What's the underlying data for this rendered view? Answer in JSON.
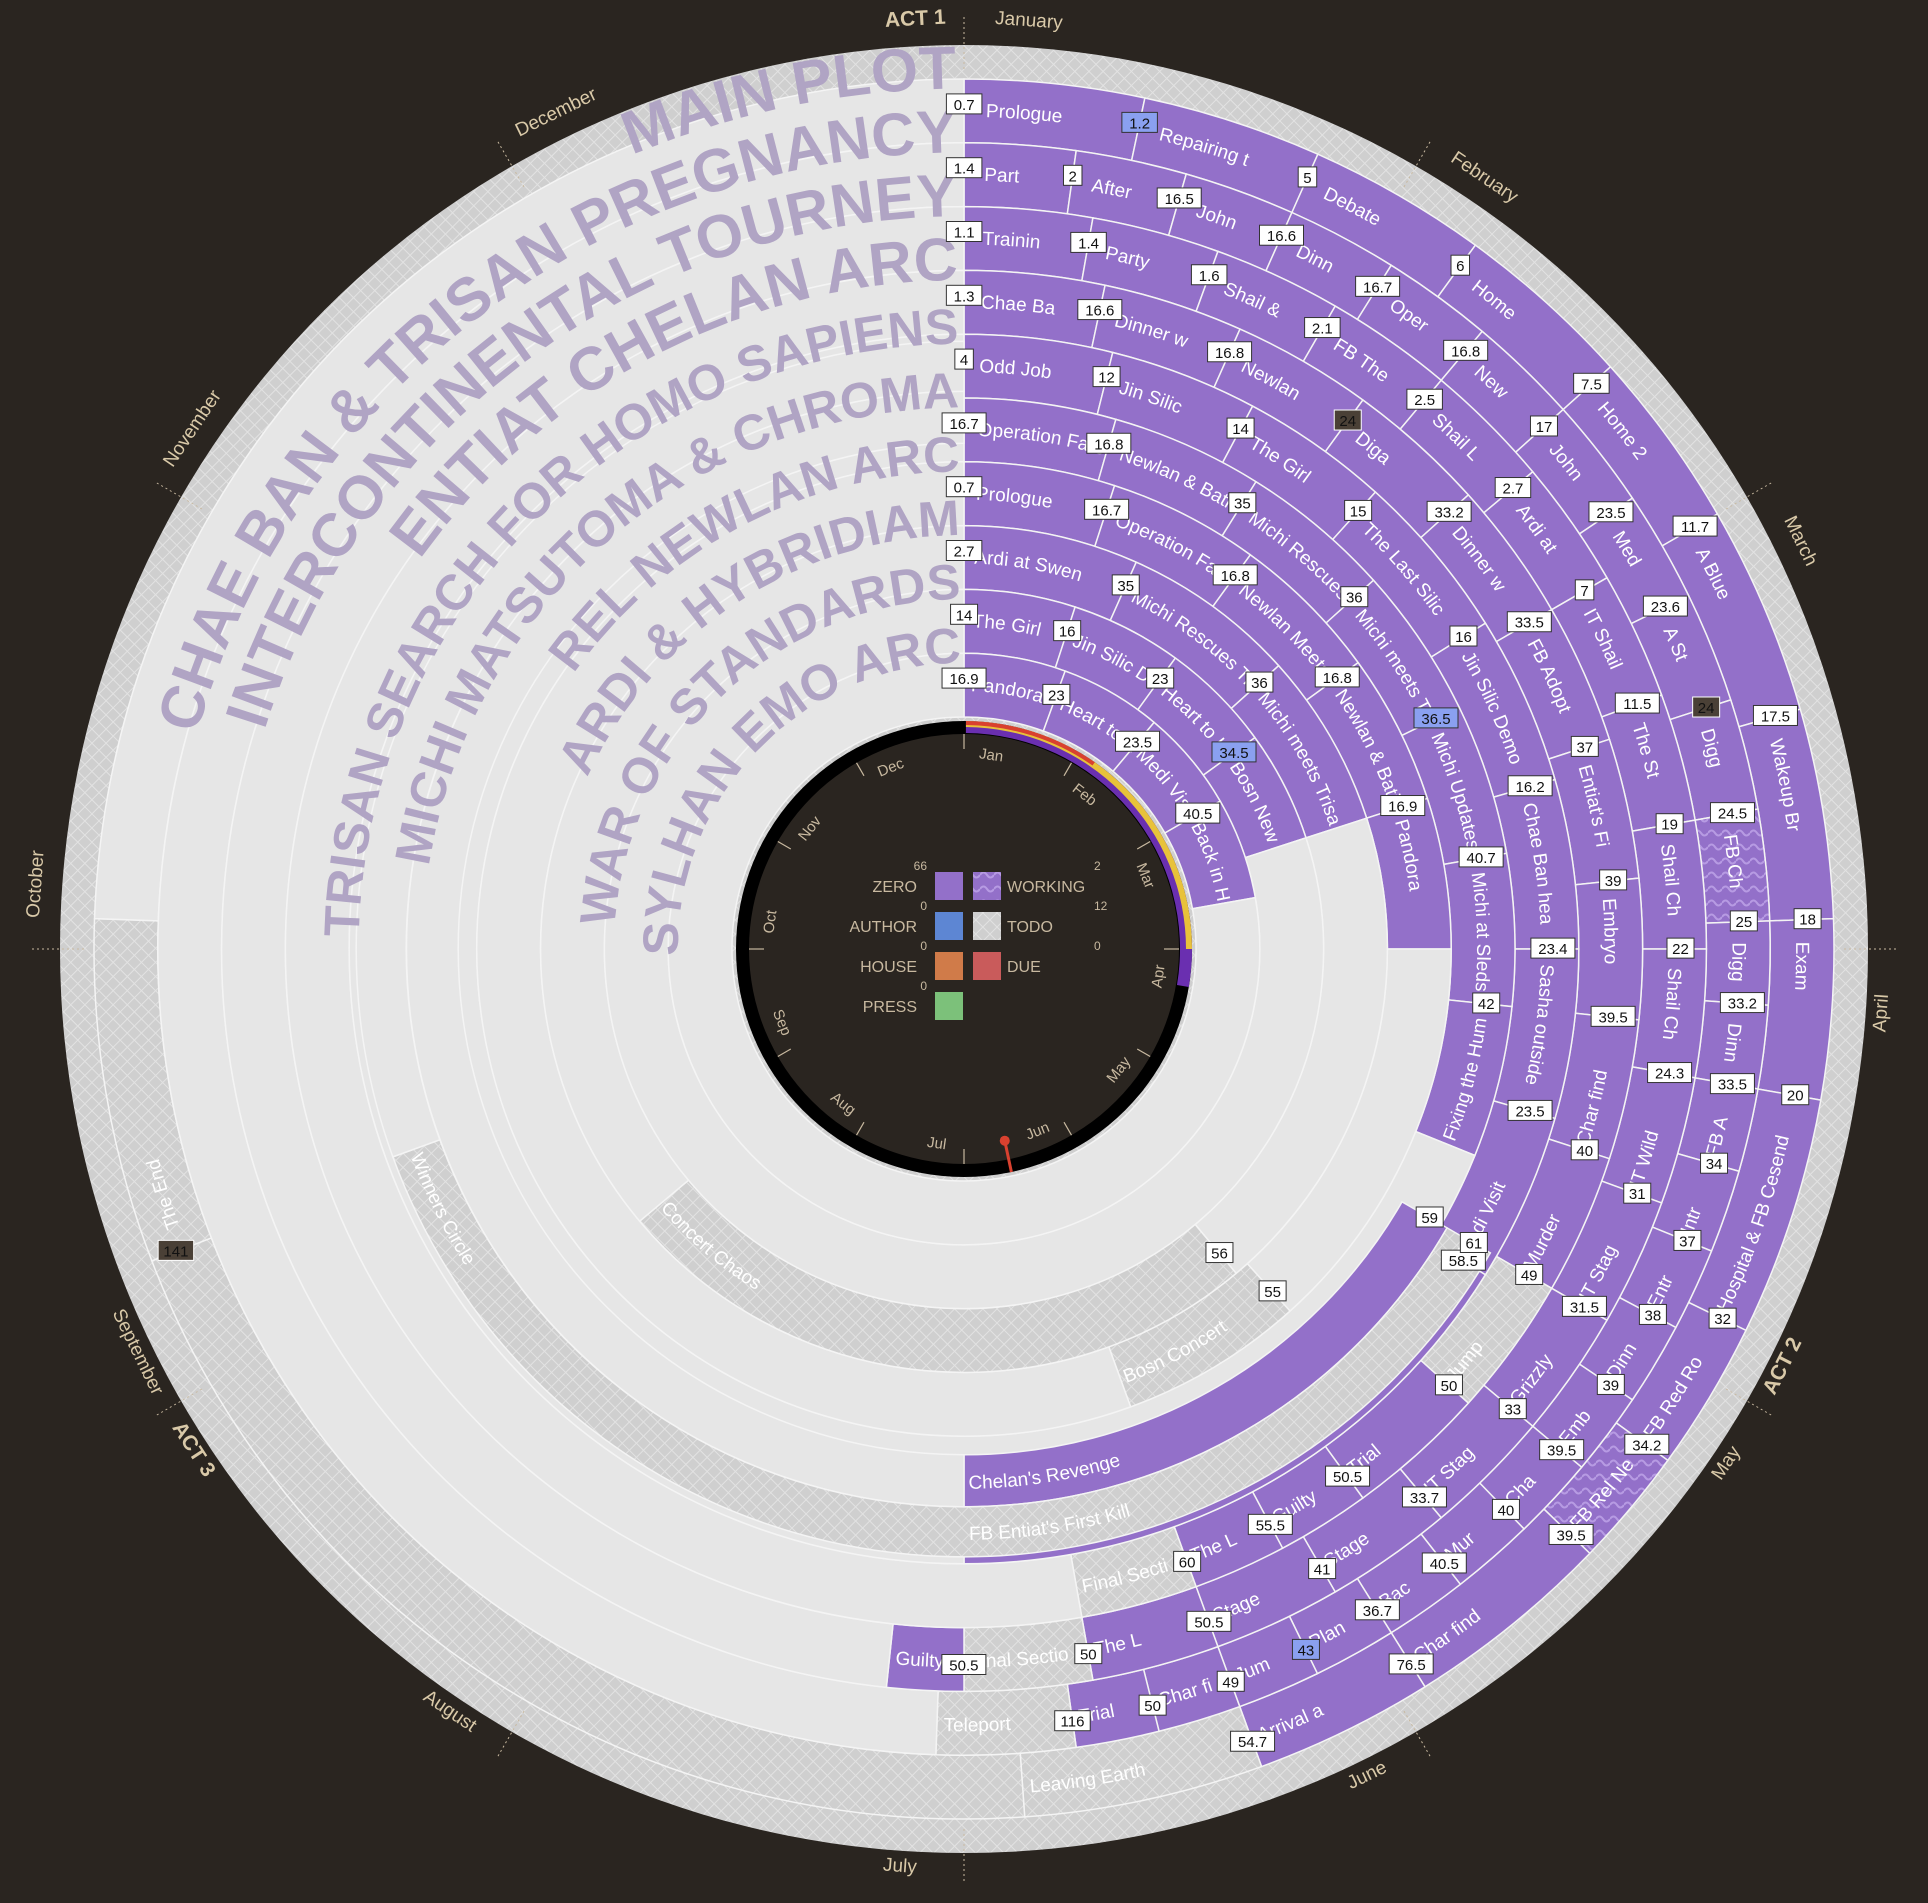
{
  "acts": [
    {
      "label": "ACT 1",
      "month": "January"
    },
    {
      "label": "ACT 2",
      "month": "May"
    },
    {
      "label": "ACT 3",
      "month": "September"
    }
  ],
  "outer_months": [
    "January",
    "February",
    "March",
    "April",
    "May",
    "June",
    "July",
    "August",
    "September",
    "October",
    "November",
    "December"
  ],
  "inner_months": [
    "Jan",
    "Feb",
    "Mar",
    "Apr",
    "May",
    "Jun",
    "Jul",
    "Aug",
    "Sep",
    "Oct",
    "Nov",
    "Dec"
  ],
  "colors": {
    "bg": "#2a2520",
    "zero": "#9370c9",
    "author": "#5d86d3",
    "house": "#d07b49",
    "due": "#c95b5b",
    "press": "#7cc17a",
    "todo": "#ececec",
    "hatch": "#cfcfcf",
    "planned": "#e6e6e6",
    "indicator": "#6a2fb0"
  },
  "legend": [
    {
      "key": "zero",
      "label": "ZERO",
      "count": "66",
      "side": "left"
    },
    {
      "key": "working",
      "label": "WORKING",
      "count": "2",
      "side": "right"
    },
    {
      "key": "author",
      "label": "AUTHOR",
      "count": "0",
      "side": "left"
    },
    {
      "key": "todo",
      "label": "TODO",
      "count": "12",
      "side": "right"
    },
    {
      "key": "house",
      "label": "HOUSE",
      "count": "0",
      "side": "left"
    },
    {
      "key": "due",
      "label": "DUE",
      "count": "0",
      "side": "right"
    },
    {
      "key": "press",
      "label": "PRESS",
      "count": "0",
      "side": "left"
    }
  ],
  "rings": [
    {
      "name": "MAIN PLOT",
      "segments": [
        {
          "title": "Prologue",
          "badge": "0.7",
          "start": 0,
          "end": 12
        },
        {
          "title": "Repairing t",
          "badge": "1.2",
          "start": 12,
          "end": 24,
          "badge_style": "highlight"
        },
        {
          "title": "Debate",
          "badge": "5",
          "start": 24,
          "end": 36
        },
        {
          "title": "Home",
          "badge": "6",
          "start": 36,
          "end": 48
        },
        {
          "title": "Home 2",
          "badge": "7.5",
          "start": 48,
          "end": 60
        },
        {
          "title": "A Blue",
          "badge": "11.7",
          "start": 60,
          "end": 74
        },
        {
          "title": "Wakeup Br",
          "badge": "17.5",
          "start": 74,
          "end": 88
        },
        {
          "title": "Exam",
          "badge": "18",
          "start": 88,
          "end": 100
        },
        {
          "title": "Hospital & FB Cesend",
          "badge": "20",
          "start": 100,
          "end": 116
        },
        {
          "title": "FB Red Ro",
          "badge": "32",
          "start": 116,
          "end": 126
        },
        {
          "title": "FB Rel New",
          "badge": "34.2",
          "start": 126,
          "end": 134,
          "hatch": true
        },
        {
          "title": "Char find",
          "badge": "39.5",
          "start": 134,
          "end": 148
        },
        {
          "title": "Arrival a",
          "badge": "76.5",
          "start": 148,
          "end": 160
        },
        {
          "title": "Leaving Earth",
          "badge": "54.7",
          "start": 160,
          "end": 176,
          "todo": true
        },
        {
          "title": "",
          "badge": "",
          "start": 176,
          "end": 249,
          "todo": true
        },
        {
          "title": "The End",
          "badge": "141",
          "start": 249,
          "end": 272,
          "todo": true,
          "badge_style": "dark"
        },
        {
          "title": "",
          "badge": "",
          "start": 272,
          "end": 360,
          "planned": true
        }
      ]
    },
    {
      "name": "CHAE BAN & TRISAN PREGNANCY",
      "segments": [
        {
          "title": "Part",
          "badge": "1.4",
          "start": 0,
          "end": 8
        },
        {
          "title": "After",
          "badge": "2",
          "start": 8,
          "end": 16
        },
        {
          "title": "John",
          "badge": "16.5",
          "start": 16,
          "end": 24
        },
        {
          "title": "Dinn",
          "badge": "16.6",
          "start": 24,
          "end": 32
        },
        {
          "title": "Oper",
          "badge": "16.7",
          "start": 32,
          "end": 40
        },
        {
          "title": "New",
          "badge": "16.8",
          "start": 40,
          "end": 48
        },
        {
          "title": "John",
          "badge": "17",
          "start": 48,
          "end": 56
        },
        {
          "title": "Med",
          "badge": "23.5",
          "start": 56,
          "end": 64
        },
        {
          "title": "A St",
          "badge": "23.6",
          "start": 64,
          "end": 72
        },
        {
          "title": "Digg",
          "badge": "24",
          "start": 72,
          "end": 80,
          "badge_style": "dark"
        },
        {
          "title": "FB Ch",
          "badge": "24.5",
          "start": 80,
          "end": 88,
          "hatch": true
        },
        {
          "title": "Digg",
          "badge": "25",
          "start": 88,
          "end": 94
        },
        {
          "title": "Dinn",
          "badge": "33.2",
          "start": 94,
          "end": 100
        },
        {
          "title": "FB A",
          "badge": "33.5",
          "start": 100,
          "end": 106
        },
        {
          "title": "Intr",
          "badge": "34",
          "start": 106,
          "end": 112
        },
        {
          "title": "Entr",
          "badge": "37",
          "start": 112,
          "end": 118
        },
        {
          "title": "Dinn",
          "badge": "38",
          "start": 118,
          "end": 124
        },
        {
          "title": "Emb",
          "badge": "39",
          "start": 124,
          "end": 130
        },
        {
          "title": "Cha",
          "badge": "39.5",
          "start": 130,
          "end": 136
        },
        {
          "title": "Mur",
          "badge": "40",
          "start": 136,
          "end": 142
        },
        {
          "title": "Bac",
          "badge": "40.5",
          "start": 142,
          "end": 148
        },
        {
          "title": "Plan",
          "badge": "36.7",
          "start": 148,
          "end": 154
        },
        {
          "title": "Jum",
          "badge": "43",
          "start": 154,
          "end": 160,
          "badge_style": "highlight"
        },
        {
          "title": "Char find",
          "badge": "49",
          "start": 160,
          "end": 166
        },
        {
          "title": "Trial",
          "badge": "50",
          "start": 166,
          "end": 172
        },
        {
          "title": "Teleport",
          "badge": "116",
          "start": 172,
          "end": 182,
          "todo": true
        },
        {
          "title": "",
          "badge": "",
          "start": 182,
          "end": 360,
          "planned": true
        }
      ]
    },
    {
      "name": "INTERCONTINENTAL TOURNEY",
      "segments": [
        {
          "title": "Trainin",
          "badge": "1.1",
          "start": 0,
          "end": 10
        },
        {
          "title": "Party",
          "badge": "1.4",
          "start": 10,
          "end": 20
        },
        {
          "title": "Shail &",
          "badge": "1.6",
          "start": 20,
          "end": 30
        },
        {
          "title": "FB The",
          "badge": "2.1",
          "start": 30,
          "end": 40
        },
        {
          "title": "Shail L",
          "badge": "2.5",
          "start": 40,
          "end": 50
        },
        {
          "title": "Ardi at",
          "badge": "2.7",
          "start": 50,
          "end": 60
        },
        {
          "title": "IT Shail",
          "badge": "7",
          "start": 60,
          "end": 70
        },
        {
          "title": "The St",
          "badge": "11.5",
          "start": 70,
          "end": 80
        },
        {
          "title": "Shail Ch",
          "badge": "19",
          "start": 80,
          "end": 90
        },
        {
          "title": "Shail Ch",
          "badge": "22",
          "start": 90,
          "end": 100
        },
        {
          "title": "IT Wild",
          "badge": "24.3",
          "start": 100,
          "end": 110
        },
        {
          "title": "IT Stag",
          "badge": "31",
          "start": 110,
          "end": 120
        },
        {
          "title": "Grizzly",
          "badge": "31.5",
          "start": 120,
          "end": 130
        },
        {
          "title": "IT Stag",
          "badge": "33",
          "start": 130,
          "end": 140
        },
        {
          "title": "Stage",
          "badge": "33.7",
          "start": 140,
          "end": 150
        },
        {
          "title": "Stage",
          "badge": "41",
          "start": 150,
          "end": 160
        },
        {
          "title": "The L",
          "badge": "50.5",
          "start": 160,
          "end": 170
        },
        {
          "title": "Final Section",
          "badge": "50",
          "start": 170,
          "end": 180,
          "todo": true
        },
        {
          "title": "Guilty",
          "badge": "50.5",
          "start": 180,
          "end": 186
        },
        {
          "title": "",
          "badge": "",
          "start": 186,
          "end": 360,
          "planned": true
        }
      ]
    },
    {
      "name": "ENTIAT CHELAN ARC",
      "segments": [
        {
          "title": "Chae Ba",
          "badge": "1.3",
          "start": 0,
          "end": 12
        },
        {
          "title": "Dinner w",
          "badge": "16.6",
          "start": 12,
          "end": 24
        },
        {
          "title": "Newlan",
          "badge": "16.8",
          "start": 24,
          "end": 36
        },
        {
          "title": "Diga",
          "badge": "24",
          "start": 36,
          "end": 48,
          "badge_style": "dark"
        },
        {
          "title": "Dinner w",
          "badge": "33.2",
          "start": 48,
          "end": 60
        },
        {
          "title": "FB Adopt",
          "badge": "33.5",
          "start": 60,
          "end": 72
        },
        {
          "title": "Entiat's Fi",
          "badge": "37",
          "start": 72,
          "end": 84
        },
        {
          "title": "Embryo",
          "badge": "39",
          "start": 84,
          "end": 96
        },
        {
          "title": "Char find",
          "badge": "39.5",
          "start": 96,
          "end": 108
        },
        {
          "title": "Murder",
          "badge": "40",
          "start": 108,
          "end": 120
        },
        {
          "title": "Jump",
          "badge": "49",
          "start": 120,
          "end": 132,
          "hatch": true
        },
        {
          "title": "Trial",
          "badge": "50",
          "start": 132,
          "end": 144
        },
        {
          "title": "Guilty",
          "badge": "50.5",
          "start": 144,
          "end": 152
        },
        {
          "title": "The L",
          "badge": "55.5",
          "start": 152,
          "end": 160
        },
        {
          "title": "Final Section",
          "badge": "60",
          "start": 160,
          "end": 170,
          "todo": true
        },
        {
          "title": "",
          "badge": "",
          "start": 170,
          "end": 360,
          "planned": true
        }
      ]
    },
    {
      "name": "TRISAN SEARCH FOR HOMO SAPIENS",
      "segments": [
        {
          "title": "Odd Job",
          "badge": "4",
          "start": 0,
          "end": 14
        },
        {
          "title": "Jin Silic",
          "badge": "12",
          "start": 14,
          "end": 28
        },
        {
          "title": "The Girl",
          "badge": "14",
          "start": 28,
          "end": 42
        },
        {
          "title": "The Last Silic",
          "badge": "15",
          "start": 42,
          "end": 58
        },
        {
          "title": "Jin Silic Demo",
          "badge": "16",
          "start": 58,
          "end": 74
        },
        {
          "title": "Chae Ban hea",
          "badge": "16.2",
          "start": 74,
          "end": 90
        },
        {
          "title": "Sasha outside",
          "badge": "23.4",
          "start": 90,
          "end": 106
        },
        {
          "title": "Medi Visit",
          "badge": "23.5",
          "start": 106,
          "end": 122
        },
        {
          "title": "FB Entiat's First Kill",
          "badge": "58.5",
          "start": 122,
          "end": 180
        },
        {
          "title": "",
          "badge": "",
          "start": 180,
          "end": 360,
          "planned": true
        }
      ]
    },
    {
      "name": "MICHI MATSUTOMA & CHROMA",
      "segments": [
        {
          "title": "Operation Fars",
          "badge": "16.7",
          "start": 0,
          "end": 16
        },
        {
          "title": "Newlan & Batia",
          "badge": "16.8",
          "start": 16,
          "end": 32
        },
        {
          "title": "Michi Rescues",
          "badge": "35",
          "start": 32,
          "end": 48
        },
        {
          "title": "Michi meets T",
          "badge": "36",
          "start": 48,
          "end": 64
        },
        {
          "title": "Michi Updates",
          "badge": "36.5",
          "start": 64,
          "end": 80,
          "badge_style": "highlight"
        },
        {
          "title": "Michi at Sleds",
          "badge": "40.7",
          "start": 80,
          "end": 96
        },
        {
          "title": "Fixing the Hum",
          "badge": "42",
          "start": 96,
          "end": 112
        },
        {
          "title": "",
          "badge": "",
          "start": 112,
          "end": 360,
          "planned": true
        }
      ]
    },
    {
      "name": "REL NEWLAN ARC",
      "segments": [
        {
          "title": "Prologue",
          "badge": "0.7",
          "start": 0,
          "end": 18
        },
        {
          "title": "Operation Farstar",
          "badge": "16.7",
          "start": 18,
          "end": 36
        },
        {
          "title": "Newlan Meets Ent",
          "badge": "16.8",
          "start": 36,
          "end": 54
        },
        {
          "title": "Newlan & Batia",
          "badge": "16.8",
          "start": 54,
          "end": 72
        },
        {
          "title": "Pandora",
          "badge": "16.9",
          "start": 72,
          "end": 90
        },
        {
          "title": "",
          "badge": "",
          "start": 90,
          "end": 138,
          "planned": true
        },
        {
          "title": "Bosn Concert",
          "badge": "55",
          "start": 138,
          "end": 160,
          "hatch": true
        },
        {
          "title": "",
          "badge": "",
          "start": 160,
          "end": 360,
          "planned": true
        }
      ]
    },
    {
      "name": "ARDI & HYBRIDIAM",
      "segments": [
        {
          "title": "Ardi at Swen",
          "badge": "2.7",
          "start": 0,
          "end": 24
        },
        {
          "title": "Michi Rescues Trisan",
          "badge": "35",
          "start": 24,
          "end": 48
        },
        {
          "title": "Michi meets Trisan",
          "badge": "36",
          "start": 48,
          "end": 72
        },
        {
          "title": "",
          "badge": "",
          "start": 72,
          "end": 140,
          "planned": true
        },
        {
          "title": "Concert Chaos",
          "badge": "56",
          "start": 140,
          "end": 230,
          "hatch": true
        },
        {
          "title": "",
          "badge": "",
          "start": 230,
          "end": 360,
          "planned": true
        }
      ]
    },
    {
      "name": "WAR OF STANDARDS",
      "segments": [
        {
          "title": "The Girl",
          "badge": "14",
          "start": 0,
          "end": 18
        },
        {
          "title": "Jin Silic Demand",
          "badge": "16",
          "start": 18,
          "end": 36
        },
        {
          "title": "Heart to Heart w",
          "badge": "23",
          "start": 36,
          "end": 54
        },
        {
          "title": "Bosn New Weap",
          "badge": "34.5",
          "start": 54,
          "end": 72,
          "badge_style": "highlight"
        },
        {
          "title": "",
          "badge": "",
          "start": 72,
          "end": 360,
          "planned": true
        }
      ]
    },
    {
      "name": "SYLHAN EMO ARC",
      "segments": [
        {
          "title": "Pandora",
          "badge": "16.9",
          "start": 0,
          "end": 20
        },
        {
          "title": "Heart to Hea",
          "badge": "23",
          "start": 20,
          "end": 40
        },
        {
          "title": "Medi Visit",
          "badge": "23.5",
          "start": 40,
          "end": 60
        },
        {
          "title": "Back in Hosp",
          "badge": "40.5",
          "start": 60,
          "end": 80
        },
        {
          "title": "",
          "badge": "",
          "start": 80,
          "end": 360,
          "planned": true
        }
      ]
    }
  ],
  "outer_extra_rings": [
    {
      "segments": [
        {
          "title": "Chelan's Revenge",
          "badge": "59",
          "start": 120,
          "end": 180,
          "zero": true
        },
        {
          "title": "",
          "badge": "",
          "start": 180,
          "end": 360,
          "planned": true
        }
      ]
    },
    {
      "segments": [
        {
          "title": "Winners Circle",
          "badge": "61",
          "start": 120,
          "end": 250,
          "hatch": true
        },
        {
          "title": "",
          "badge": "",
          "start": 250,
          "end": 360,
          "planned": true
        }
      ]
    }
  ],
  "progress": {
    "fraction": 0.42,
    "pointer_month": "Jun"
  }
}
